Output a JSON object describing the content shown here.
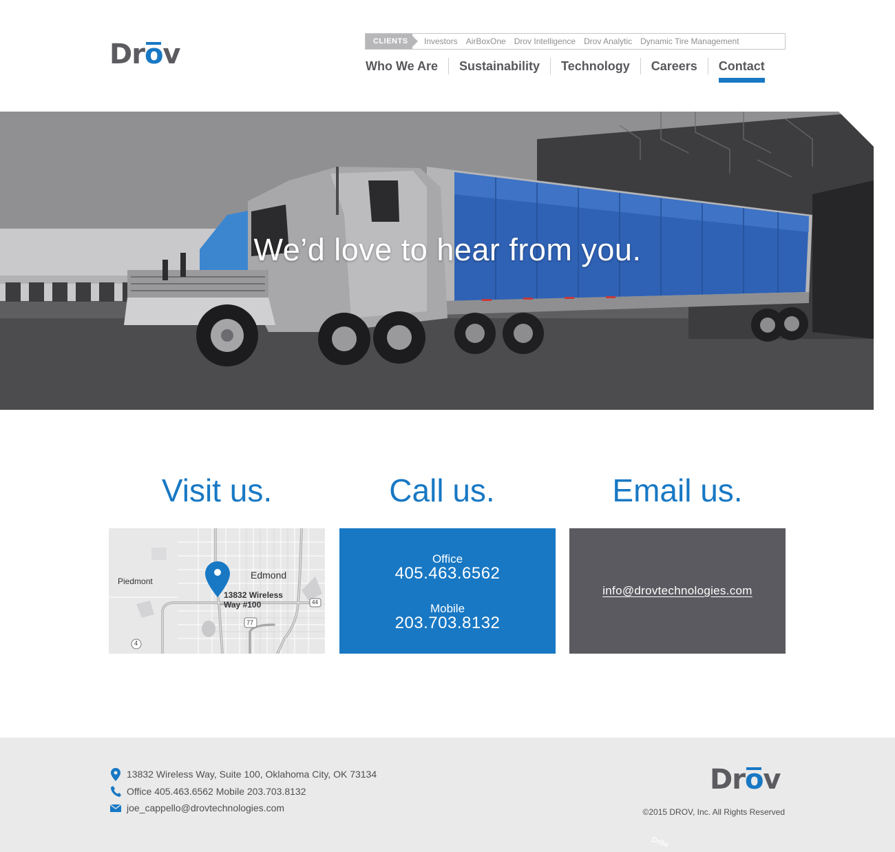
{
  "brand": {
    "logo_text_pre": "Dr",
    "logo_text_o": "o",
    "logo_text_post": "v"
  },
  "clients_bar": {
    "label": "CLIENTS",
    "links": [
      "Investors",
      "AirBoxOne",
      "Drov Intelligence",
      "Drov Analytic",
      "Dynamic Tire Management"
    ]
  },
  "main_nav": {
    "items": [
      "Who We Are",
      "Sustainability",
      "Technology",
      "Careers",
      "Contact"
    ],
    "active": "Contact"
  },
  "hero": {
    "title": "We’d love to hear from you."
  },
  "contact": {
    "visit": {
      "title": "Visit us.",
      "map_labels": {
        "city1": "Piedmont",
        "city2": "Edmond",
        "address_line1": "13832 Wireless",
        "address_line2": "Way #100",
        "route_44": "44",
        "route_77": "77",
        "route_4": "4"
      }
    },
    "call": {
      "title": "Call us.",
      "office_label": "Office",
      "office_number": "405.463.6562",
      "mobile_label": "Mobile",
      "mobile_number": "203.703.8132"
    },
    "email": {
      "title": "Email us.",
      "address": "info@drovtechnologies.com"
    }
  },
  "footer": {
    "address": "13832 Wireless Way, Suite 100, Oklahoma City, OK 73134",
    "phones": "Office 405.463.6562  Mobile 203.703.8132",
    "email": "joe_cappello@drovtechnologies.com",
    "copyright": "©2015 DROV, Inc. All Rights Reserved",
    "watermark": "Drōv"
  },
  "colors": {
    "accent": "#1878c4",
    "dark_gray": "#5a5a60",
    "footer_bg": "#eaeaea",
    "text": "#555559"
  },
  "icons": [
    "map-pin-icon",
    "phone-icon",
    "mail-icon"
  ]
}
